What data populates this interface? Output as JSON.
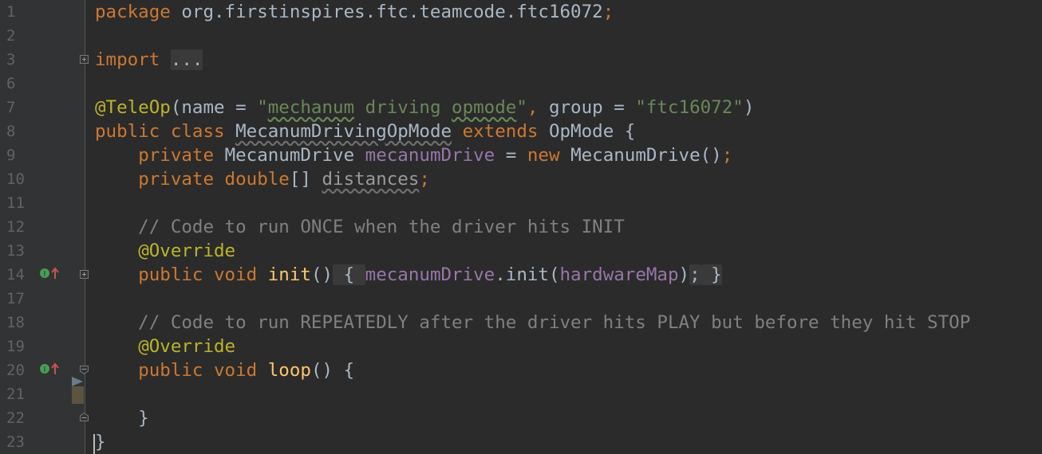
{
  "line_numbers": [
    "1",
    "2",
    "3",
    "6",
    "7",
    "8",
    "9",
    "10",
    "11",
    "12",
    "13",
    "14",
    "17",
    "18",
    "19",
    "20",
    "21",
    "22",
    "23"
  ],
  "code": {
    "l1": {
      "kw": "package",
      "rest": " org.firstinspires.ftc.teamcode.ftc16072",
      "semi": ";"
    },
    "l3": {
      "kw": "import",
      "folded": "..."
    },
    "l7": {
      "ann": "@TeleOp",
      "p1": "(name = ",
      "q1": "\"",
      "s1": "mechanum",
      "s2": " driving ",
      "s3": "opmode",
      "q2": "\"",
      "comma": ",",
      "p2": " group = ",
      "s4": "\"ftc16072\"",
      "p3": ")"
    },
    "l8": {
      "kw1": "public class ",
      "cls": "MecanumDrivingOpMode",
      "kw2": " extends ",
      "base": "OpMode {"
    },
    "l9": {
      "indent": "    ",
      "kw1": "private ",
      "type": "MecanumDrive ",
      "field": "mecanumDrive",
      "eq": " = ",
      "kw2": "new ",
      "ctor": "MecanumDrive()",
      "semi": ";"
    },
    "l10": {
      "indent": "    ",
      "kw1": "private double",
      "br": "[] ",
      "field": "distances",
      "semi": ";"
    },
    "l12": {
      "text": "    // Code to run ONCE when the driver hits INIT"
    },
    "l13": {
      "indent": "    ",
      "ann": "@Override"
    },
    "l14": {
      "indent": "    ",
      "kw": "public void ",
      "meth": "init",
      "paren": "()",
      "ob": " { ",
      "field1": "mecanumDrive",
      "call": ".init(",
      "field2": "hardwareMap",
      "cp": ")",
      "semi": ";",
      "cb": " }"
    },
    "l18": {
      "text": "    // Code to run REPEATEDLY after the driver hits PLAY but before they hit STOP"
    },
    "l19": {
      "indent": "    ",
      "ann": "@Override"
    },
    "l20": {
      "indent": "    ",
      "kw": "public void ",
      "meth": "loop",
      "rest": "() {"
    },
    "l22": {
      "text": "    }"
    },
    "l23": {
      "text": "}"
    }
  },
  "icons": {
    "override": "implements-method-icon",
    "fold": "fold-toggle-icon"
  },
  "colors": {
    "background": "#2b2b2b",
    "gutter": "#313335",
    "keyword": "#cc7832",
    "annotation": "#bbb529",
    "string": "#6a8759",
    "comment": "#808080",
    "field": "#9876aa",
    "method": "#ffc66d",
    "text": "#a9b7c6"
  }
}
